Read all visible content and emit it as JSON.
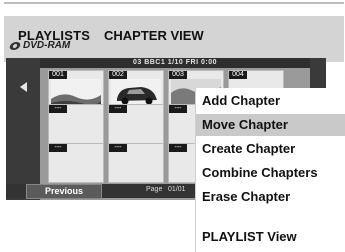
{
  "header": {
    "playlists": "PLAYLISTS",
    "media": "DVD-RAM",
    "chapter_view": "CHAPTER VIEW"
  },
  "infobar": "03   BBC1   1/10  FRI   0:00",
  "thumbs": [
    {
      "num": "001"
    },
    {
      "num": "002"
    },
    {
      "num": "003"
    },
    {
      "num": "004"
    },
    {
      "num": "---"
    },
    {
      "num": "---"
    },
    {
      "num": "---"
    },
    {
      "num": "---"
    },
    {
      "num": "---"
    },
    {
      "num": "---"
    }
  ],
  "footer": {
    "previous": "Previous",
    "page_label": "Page",
    "page_value": "01/01"
  },
  "menu": {
    "items": [
      {
        "label": "Add Chapter"
      },
      {
        "label": "Move Chapter"
      },
      {
        "label": "Create Chapter"
      },
      {
        "label": "Combine Chapters"
      },
      {
        "label": "Erase Chapter"
      },
      {
        "label": "PLAYLIST View"
      }
    ],
    "selected": "Move Chapter"
  }
}
